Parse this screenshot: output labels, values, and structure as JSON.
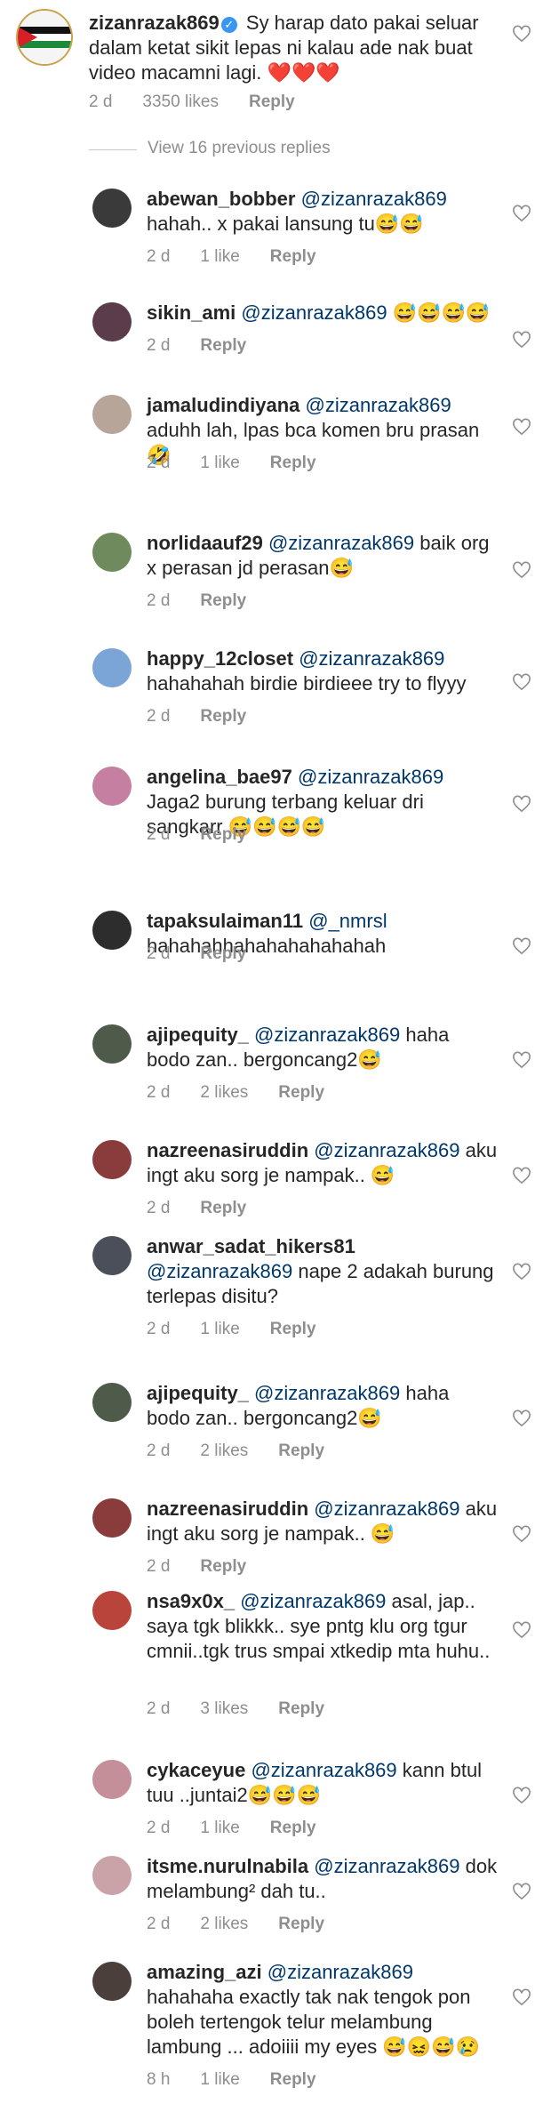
{
  "parent": {
    "username": "zizanrazak869",
    "text": "Sy harap dato pakai seluar dalam ketat sikit lepas ni kalau ade nak buat video macamni lagi.",
    "emoji": "❤️❤️❤️",
    "time": "2 d",
    "likes": "3350 likes",
    "reply": "Reply"
  },
  "view_previous": "View 16 previous replies",
  "replies": [
    {
      "username": "abewan_bobber",
      "mention": "@zizanrazak869",
      "text": "hahah.. x pakai lansung tu😅😅",
      "time": "2 d",
      "likes": "1 like",
      "reply": "Reply",
      "avatar_color": "#3a3a3a"
    },
    {
      "username": "sikin_ami",
      "mention": "@zizanrazak869",
      "text": "😅😅😅😅",
      "time": "2 d",
      "likes": "",
      "reply": "Reply",
      "avatar_color": "#5b3c4b"
    },
    {
      "username": "jamaludindiyana",
      "mention": "@zizanrazak869",
      "text": "aduhh lah, lpas bca komen bru prasan 🤣",
      "time": "2 d",
      "likes": "1 like",
      "reply": "Reply",
      "avatar_color": "#b7a59a"
    },
    {
      "username": "norlidaauf29",
      "mention": "@zizanrazak869",
      "text": "baik org x perasan jd perasan😅",
      "time": "2 d",
      "likes": "",
      "reply": "Reply",
      "avatar_color": "#6f8a5c"
    },
    {
      "username": "happy_12closet",
      "mention": "@zizanrazak869",
      "text": "hahahahah birdie birdieee try to flyyy",
      "time": "2 d",
      "likes": "",
      "reply": "Reply",
      "avatar_color": "#7aa5d6"
    },
    {
      "username": "angelina_bae97",
      "mention": "@zizanrazak869",
      "text": "Jaga2 burung terbang keluar dri sangkarr 😅😅😅😅",
      "time": "2 d",
      "likes": "",
      "reply": "Reply",
      "avatar_color": "#c57fa0"
    },
    {
      "username": "tapaksulaiman11",
      "mention": "@_nmrsl",
      "text": "hahahahhahahahahahahah",
      "time": "2 d",
      "likes": "",
      "reply": "Reply",
      "avatar_color": "#2d2d2d"
    },
    {
      "username": "ajipequity_",
      "mention": "@zizanrazak869",
      "text": "haha bodo zan.. bergoncang2😅",
      "time": "2 d",
      "likes": "2 likes",
      "reply": "Reply",
      "avatar_color": "#4e5a4a"
    },
    {
      "username": "nazreenasiruddin",
      "mention": "@zizanrazak869",
      "text": "aku ingt aku sorg je nampak.. 😅",
      "time": "2 d",
      "likes": "",
      "reply": "Reply",
      "avatar_color": "#8a3b3b"
    },
    {
      "username": "anwar_sadat_hikers81",
      "mention": "@zizanrazak869",
      "text": "nape 2 adakah burung terlepas disitu?",
      "time": "2 d",
      "likes": "1 like",
      "reply": "Reply",
      "avatar_color": "#4a4f59"
    },
    {
      "username": "ajipequity_",
      "mention": "@zizanrazak869",
      "text": "haha bodo zan.. bergoncang2😅",
      "time": "2 d",
      "likes": "2 likes",
      "reply": "Reply",
      "avatar_color": "#4e5a4a"
    },
    {
      "username": "nazreenasiruddin",
      "mention": "@zizanrazak869",
      "text": "aku ingt aku sorg je nampak.. 😅",
      "time": "2 d",
      "likes": "",
      "reply": "Reply",
      "avatar_color": "#8a3b3b"
    },
    {
      "username": "nsa9x0x_",
      "mention": "@zizanrazak869",
      "text": "asal, jap.. saya tgk blikkk.. sye pntg klu org tgur cmnii..tgk trus smpai xtkedip mta huhu..",
      "time": "2 d",
      "likes": "3 likes",
      "reply": "Reply",
      "avatar_color": "#b8443c"
    },
    {
      "username": "cykaceyue",
      "mention": "@zizanrazak869",
      "text": "kann btul tuu ..juntai2😅😅😅",
      "time": "2 d",
      "likes": "1 like",
      "reply": "Reply",
      "avatar_color": "#c48f99"
    },
    {
      "username": "itsme.nurulnabila",
      "mention": "@zizanrazak869",
      "text": "dok melambung² dah tu..",
      "time": "2 d",
      "likes": "2 likes",
      "reply": "Reply",
      "avatar_color": "#c9a3a8"
    },
    {
      "username": "amazing_azi",
      "mention": "@zizanrazak869",
      "text": "hahahaha exactly tak nak tengok pon boleh tertengok telur melambung lambung ... adoiiii my eyes 😅😖😅😢",
      "time": "8 h",
      "likes": "1 like",
      "reply": "Reply",
      "avatar_color": "#4b3f3c"
    }
  ],
  "colors": {
    "text": "#262626",
    "meta": "#8e8e8e",
    "mention": "#00376b",
    "verified": "#3897f0"
  },
  "icons": {
    "like": "heart-outline-icon",
    "verified": "verified-badge-icon"
  }
}
